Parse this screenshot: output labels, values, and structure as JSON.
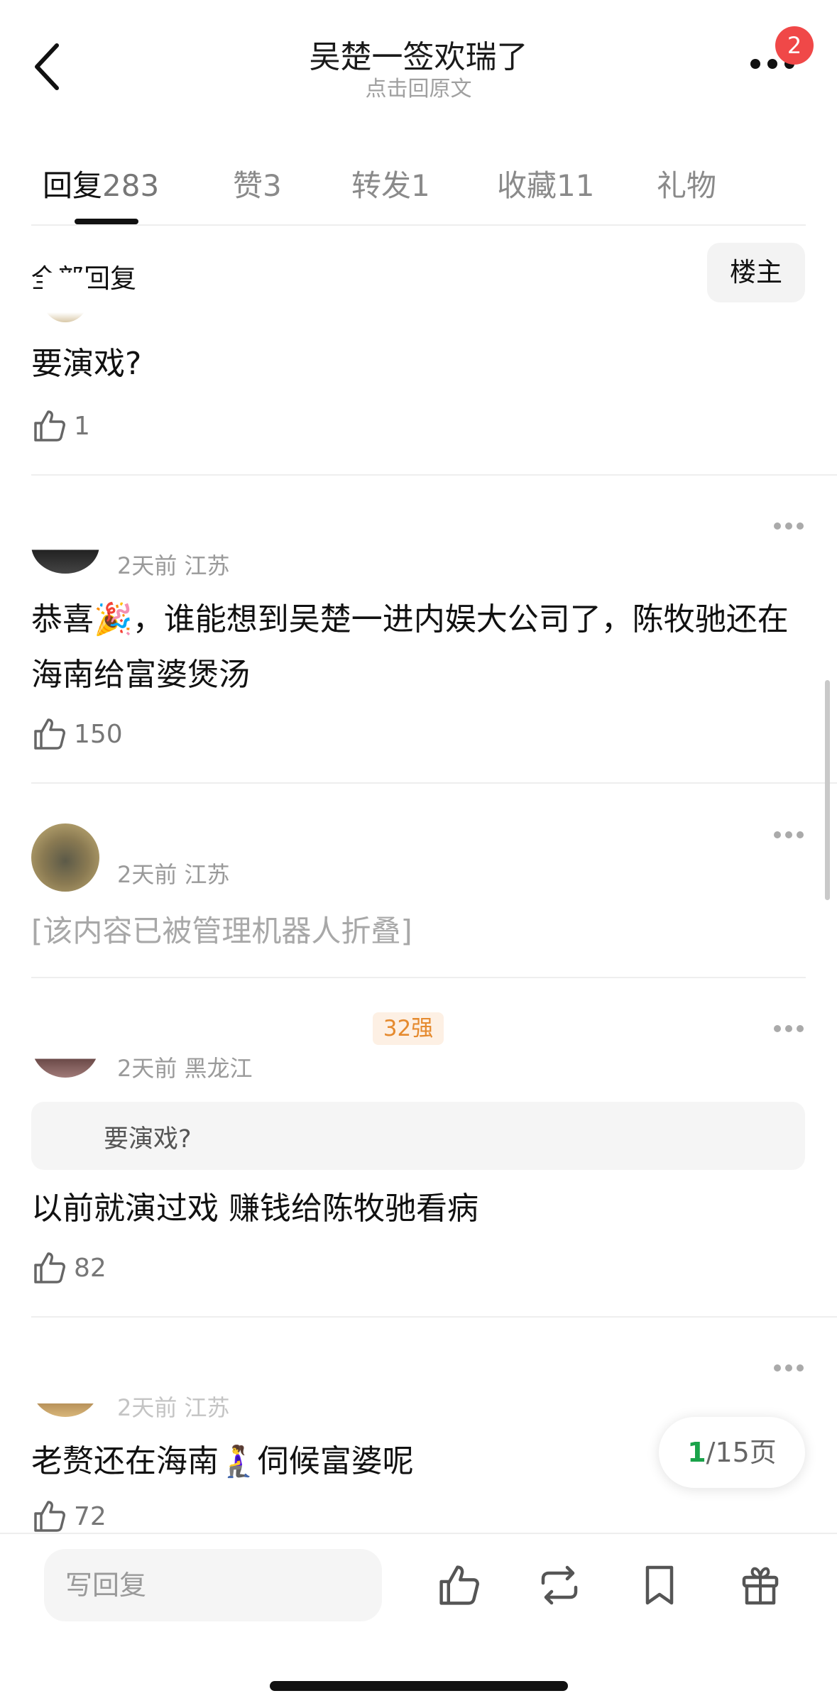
{
  "header": {
    "title": "吴楚一签欢瑞了",
    "subtitle": "点击回原文",
    "notification_count": "2",
    "icons": [
      "chevron-left-icon",
      "more-dots-icon"
    ]
  },
  "tabs": [
    {
      "label": "回复",
      "count": "283",
      "active": true
    },
    {
      "label": "赞",
      "count": "3"
    },
    {
      "label": "转发",
      "count": "1"
    },
    {
      "label": "收藏",
      "count": "11"
    },
    {
      "label": "礼物",
      "count": ""
    }
  ],
  "section": {
    "label": "全部回复",
    "owner_button": "楼主"
  },
  "comments": [
    {
      "text": "要演戏?",
      "likes": "1"
    },
    {
      "meta": "2天前 江苏",
      "text": "恭喜🎉，谁能想到吴楚一进内娱大公司了，陈牧驰还在海南给富婆煲汤",
      "likes": "150"
    },
    {
      "meta": "2天前 江苏",
      "text": "[该内容已被管理机器人折叠]"
    },
    {
      "tag": "32强",
      "meta": "2天前 黑龙江",
      "quote": "要演戏?",
      "text": "以前就演过戏 赚钱给陈牧驰看病",
      "likes": "82"
    },
    {
      "meta": "2天前 江苏",
      "text": "老赘还在海南🧎‍♀️伺候富婆呢",
      "likes": "72"
    }
  ],
  "pager": {
    "current": "1",
    "total": "/15页"
  },
  "bottom_bar": {
    "reply_placeholder": "写回复",
    "icons": [
      "thumbs-up-icon",
      "repost-icon",
      "bookmark-icon",
      "gift-icon"
    ]
  },
  "colors": {
    "accent_green": "#1aa34a",
    "badge_red": "#f04848",
    "tag_orange": "#e58a2e"
  }
}
